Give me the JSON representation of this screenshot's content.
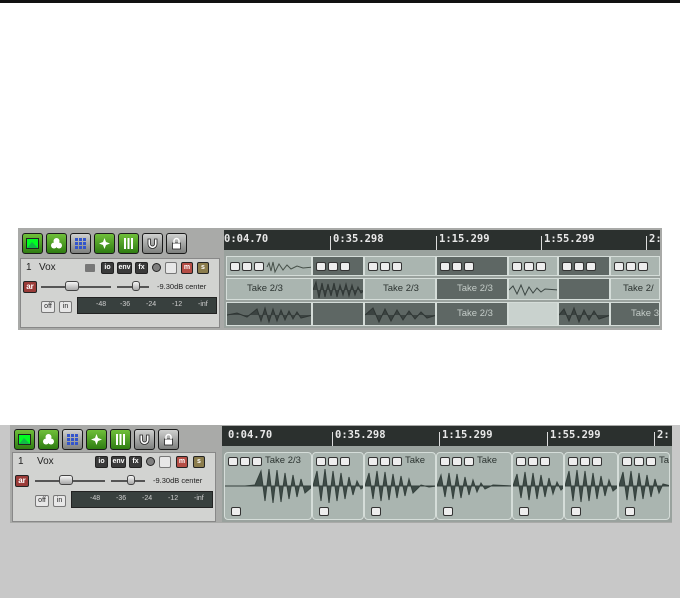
{
  "panels": [
    {
      "id": "top",
      "track": {
        "number": "1",
        "name": "Vox",
        "buttons": {
          "io": "io",
          "env": "env",
          "fx": "fx",
          "mute": "m",
          "solo": "s",
          "arm": "ar",
          "off": "off",
          "in": "in"
        },
        "volume_readout": "-9.30dB center",
        "meter_labels": [
          "-48",
          "-36",
          "-24",
          "-12",
          "-inf"
        ]
      },
      "ruler": [
        "0:04.70",
        "0:35.298",
        "1:15.299",
        "1:55.299",
        "2:"
      ],
      "take_labels": [
        "Take 2/3",
        "Take 2/3",
        "Take 2/3",
        "Take 2/3",
        "Take 2/",
        "Take 3/"
      ]
    },
    {
      "id": "bottom",
      "track": {
        "number": "1",
        "name": "Vox",
        "buttons": {
          "io": "io",
          "env": "env",
          "fx": "fx",
          "mute": "m",
          "solo": "s",
          "arm": "ar",
          "off": "off",
          "in": "in"
        },
        "volume_readout": "-9.30dB center",
        "meter_labels": [
          "-48",
          "-36",
          "-24",
          "-12",
          "-inf"
        ]
      },
      "ruler": [
        "0:04.70",
        "0:35.298",
        "1:15.299",
        "1:55.299",
        "2:"
      ],
      "take_labels": [
        "Take 2/3",
        "Take",
        "Take",
        "Take"
      ]
    }
  ],
  "toolbar_icons": [
    "image-icon",
    "clover-icon",
    "grid-icon",
    "snap-icon",
    "bars-icon",
    "magnet-icon",
    "lock-icon"
  ]
}
